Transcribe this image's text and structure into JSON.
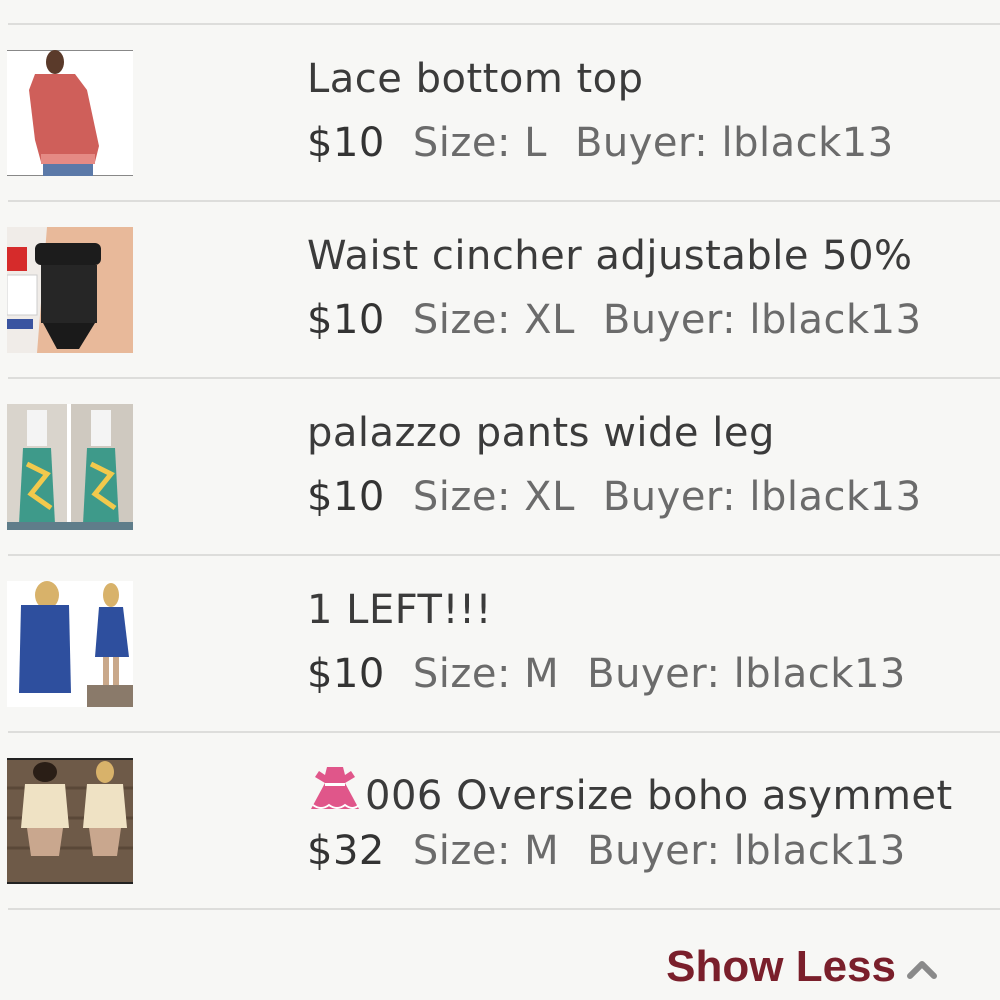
{
  "items": [
    {
      "title": "Lace bottom top",
      "price": "$10",
      "size": "Size: L",
      "buyer": "Buyer: lblack13"
    },
    {
      "title": "Waist cincher adjustable 50%",
      "price": "$10",
      "size": "Size: XL",
      "buyer": "Buyer: lblack13"
    },
    {
      "title": "palazzo pants wide leg",
      "price": "$10",
      "size": "Size: XL",
      "buyer": "Buyer: lblack13"
    },
    {
      "title": "1 LEFT!!!",
      "price": "$10",
      "size": "Size: M",
      "buyer": "Buyer: lblack13"
    },
    {
      "title": "006 Oversize boho asymmet",
      "price": "$32",
      "size": "Size: M",
      "buyer": "Buyer: lblack13",
      "title_icon": "dress-icon"
    }
  ],
  "footer": {
    "show_less_label": "Show Less",
    "icon": "chevron-up-icon"
  },
  "colors": {
    "accent": "#7a1f2b",
    "text": "#3b3b3b",
    "muted": "#6b6b6b",
    "divider": "#dddddb",
    "dress_icon": "#e0568a"
  }
}
